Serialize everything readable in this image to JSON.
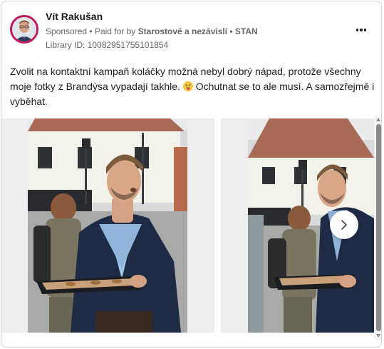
{
  "ad": {
    "advertiser_name": "Vít Rakušan",
    "sponsored_label": "Sponsored",
    "separator": "•",
    "paid_for_prefix": "Paid for by",
    "paid_for_by": "Starostové a nezávislí • STAN",
    "library_id": "Library ID: 10082951755101854",
    "body_before_emoji": "Zvolit na kontaktní kampaň koláčky možná nebyl dobrý nápad, protože všechny moje fotky z Brandýsa vypadají takhle.",
    "body_after_emoji": "Ochutnat se to ale musí. A samozřejmě i vyběhat."
  },
  "icons": {
    "avatar": "profile-photo",
    "more": "three-dots-icon",
    "emoji": "winking-tongue-emoji",
    "next": "chevron-right-icon"
  },
  "colors": {
    "avatar_ring": "#c2185b",
    "text_primary": "#1c1e21",
    "text_secondary": "#65676b"
  }
}
